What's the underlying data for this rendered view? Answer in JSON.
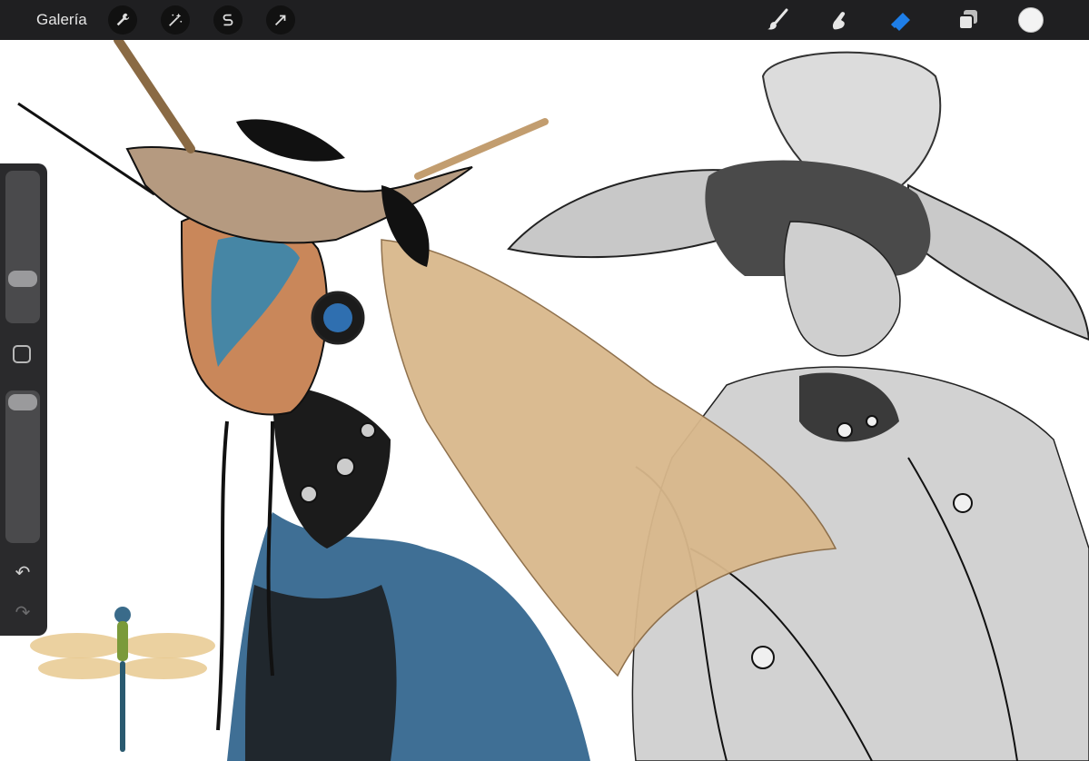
{
  "toolbar": {
    "gallery_label": "Galería",
    "left_tools": [
      "wrench-icon",
      "magic-wand-icon",
      "selection-s-icon",
      "transform-arrow-icon"
    ],
    "right_tools": [
      "brush-icon",
      "smudge-icon",
      "eraser-icon",
      "layers-icon"
    ],
    "active_tool": "eraser-icon",
    "active_color": "#f3f3f3",
    "accent": "#1e7ee8"
  },
  "sidebar": {
    "brush_size_level": 0.65,
    "opacity_level": 0.05,
    "modify_button": "square-icon",
    "undo": "↶",
    "redo": "↷"
  },
  "canvas": {
    "colors": {
      "skin": "#c9875a",
      "blue": "#3f6f95",
      "wing": "#d9b88c",
      "ink": "#141414",
      "sketch_gray": "#a9a9a9"
    }
  }
}
